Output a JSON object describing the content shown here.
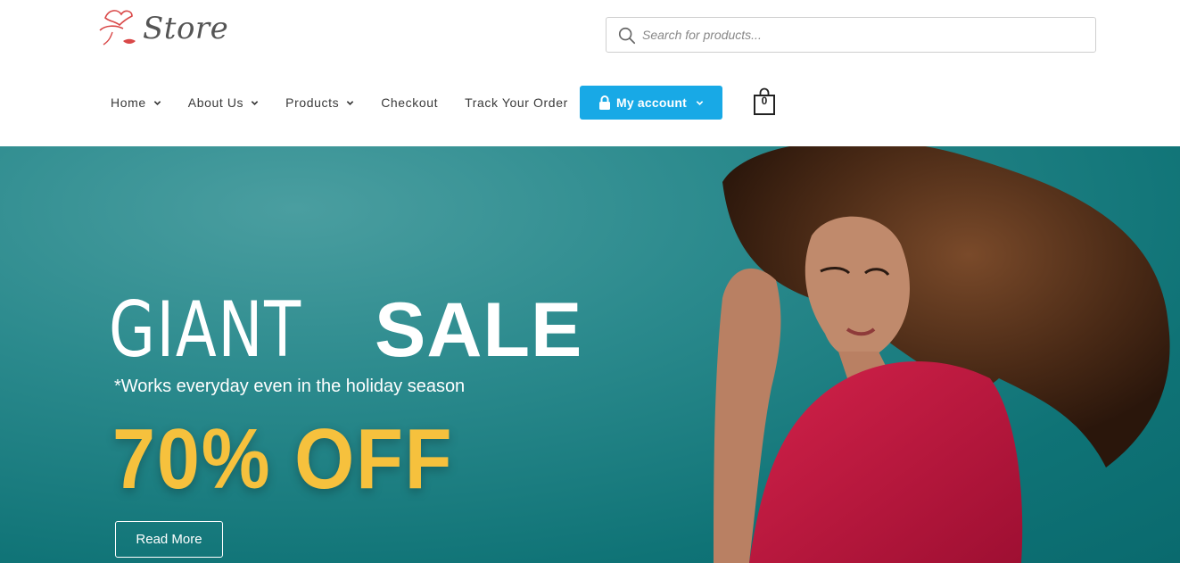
{
  "logo": {
    "text": "Store",
    "icon": "hat-lips-logo"
  },
  "search": {
    "placeholder": "Search for products...",
    "icon": "search-icon"
  },
  "nav": {
    "items": [
      {
        "label": "Home",
        "dropdown": true
      },
      {
        "label": "About Us",
        "dropdown": true
      },
      {
        "label": "Products",
        "dropdown": true
      },
      {
        "label": "Checkout",
        "dropdown": false
      },
      {
        "label": "Track Your Order",
        "dropdown": false
      }
    ],
    "account": {
      "label": "My account",
      "icon": "lock-icon",
      "color": "#18a9e6"
    },
    "cart": {
      "count": "0",
      "icon": "shopping-bag-icon"
    }
  },
  "hero": {
    "headline_light": "GIANT",
    "headline_bold": "SALE",
    "subline": "*Works everyday even in the holiday season",
    "promo": "70% OFF",
    "promo_color": "#f6c13d",
    "button_label": "Read More",
    "background_color": "#0f7376"
  }
}
